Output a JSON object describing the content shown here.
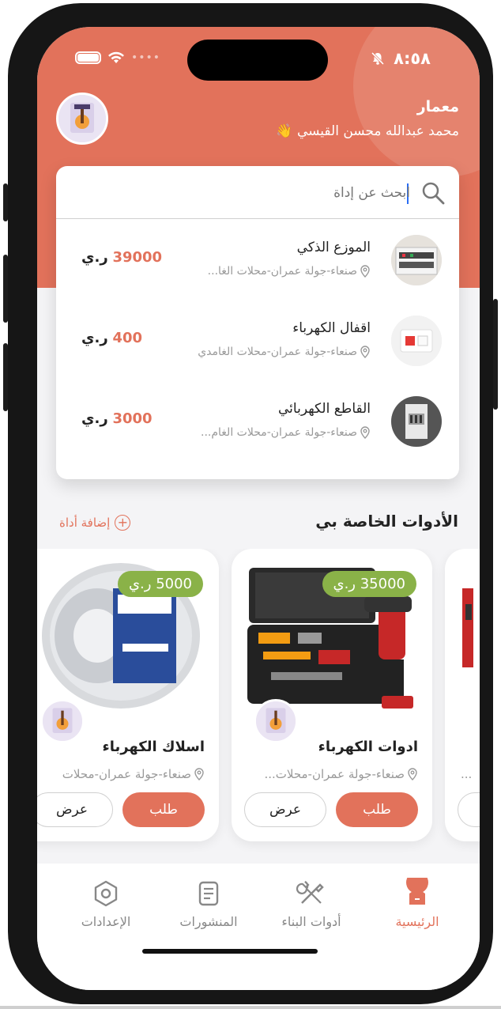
{
  "status_bar": {
    "time": "٨:٥٨"
  },
  "user": {
    "role": "معمار",
    "name": "محمد عبدالله محسن القيسي 👋"
  },
  "search": {
    "placeholder": "ابحث عن إداة"
  },
  "search_results": [
    {
      "title": "الموزع الذكي",
      "location": "صنعاء-جولة عمران-محلات الغا...",
      "price": "39000",
      "currency": "ر.ي"
    },
    {
      "title": "اقفال الكهرباء",
      "location": "صنعاء-جولة عمران-محلات الغامدي",
      "price": "400",
      "currency": "ر.ي"
    },
    {
      "title": "القاطع الكهربائي",
      "location": "صنعاء-جولة عمران-محلات الغام...",
      "price": "3000",
      "currency": "ر.ي"
    }
  ],
  "section": {
    "title": "الأدوات الخاصة بي",
    "add_label": "إضافة أداة"
  },
  "products": [
    {
      "title": "ادوات الكهرباء",
      "location": "صنعاء-جولة عمران-محلات...",
      "price": "35000 ر.ي",
      "order_label": "طلب",
      "view_label": "عرض"
    },
    {
      "title": "اسلاك الكهرباء",
      "location": "صنعاء-جولة عمران-محلات",
      "price": "5000 ر.ي",
      "order_label": "طلب",
      "view_label": "عرض"
    },
    {
      "location": "..."
    }
  ],
  "tabs": [
    {
      "label": "الرئيسية",
      "icon": "home-icon",
      "active": true
    },
    {
      "label": "أدوات البناء",
      "icon": "tools-icon",
      "active": false
    },
    {
      "label": "المنشورات",
      "icon": "posts-icon",
      "active": false
    },
    {
      "label": "الإعدادات",
      "icon": "settings-icon",
      "active": false
    }
  ],
  "colors": {
    "primary": "#e2725b",
    "price_tag": "#8ab248",
    "background": "#f4f4f6"
  }
}
